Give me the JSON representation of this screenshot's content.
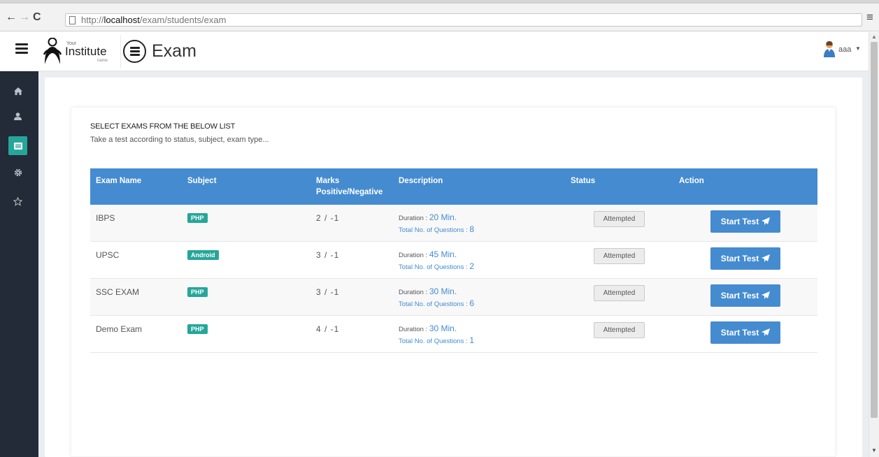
{
  "browser": {
    "url_prefix": "http://",
    "url_host": "localhost",
    "url_path": "/exam/students/exam",
    "back_icon": "back-arrow-icon",
    "forward_icon": "forward-arrow-icon",
    "reload_icon": "reload-icon",
    "menu_icon": "browser-menu-icon"
  },
  "header": {
    "logo_small": "Your",
    "logo_main": "Institute",
    "logo_sub": "name",
    "title": "Exam",
    "user_name": "aaa"
  },
  "sidebar": {
    "items": [
      {
        "icon": "home-icon",
        "active": false
      },
      {
        "icon": "user-icon",
        "active": false
      },
      {
        "icon": "list-icon",
        "active": true
      },
      {
        "icon": "gear-icon",
        "active": false
      },
      {
        "icon": "star-icon",
        "active": false
      }
    ]
  },
  "main": {
    "heading": "SELECT EXAMS FROM THE BELOW LIST",
    "subtitle": "Take a test according to status, subject, exam type...",
    "columns": {
      "exam_name": "Exam Name",
      "subject": "Subject",
      "marks_line1": "Marks",
      "marks_line2": "Positive/Negative",
      "description": "Description",
      "status": "Status",
      "action": "Action"
    },
    "duration_label": "Duration : ",
    "questions_label": "Total No. of Questions : ",
    "rows": [
      {
        "name": "IBPS",
        "subject": "PHP",
        "marks": "2 / -1",
        "duration": "20 Min.",
        "questions": "8",
        "status": "Attempted",
        "action": "Start Test"
      },
      {
        "name": "UPSC",
        "subject": "Android",
        "marks": "3 / -1",
        "duration": "45 Min.",
        "questions": "2",
        "status": "Attempted",
        "action": "Start Test"
      },
      {
        "name": "SSC EXAM",
        "subject": "PHP",
        "marks": "3 / -1",
        "duration": "30 Min.",
        "questions": "6",
        "status": "Attempted",
        "action": "Start Test"
      },
      {
        "name": "Demo Exam",
        "subject": "PHP",
        "marks": "4 / -1",
        "duration": "30 Min.",
        "questions": "1",
        "status": "Attempted",
        "action": "Start Test"
      }
    ]
  },
  "colors": {
    "sidebar_bg": "#222b37",
    "accent_teal": "#26a69a",
    "table_header_blue": "#458bd0"
  }
}
